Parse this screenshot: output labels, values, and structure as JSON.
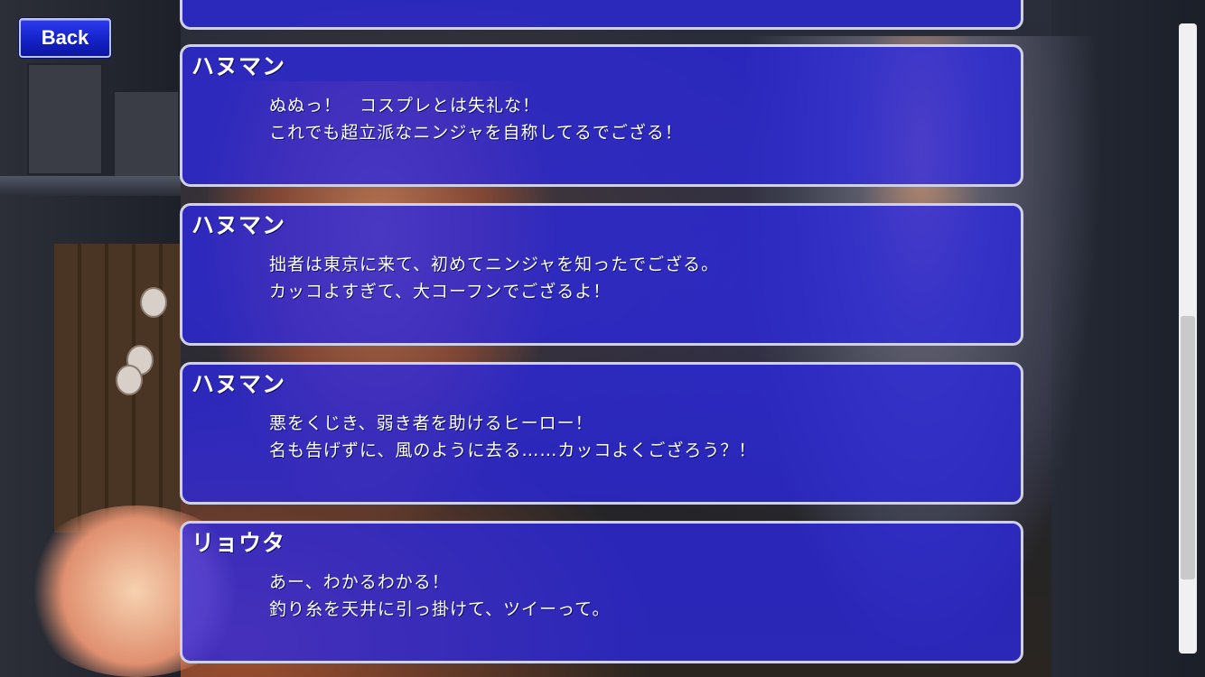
{
  "back_label": "Back",
  "log": [
    {
      "speaker": "",
      "lines": [
        "",
        ""
      ]
    },
    {
      "speaker": "ハヌマン",
      "lines": [
        "ぬぬっ！　コスプレとは失礼な！",
        "これでも超立派なニンジャを自称してるでござる！"
      ]
    },
    {
      "speaker": "ハヌマン",
      "lines": [
        "拙者は東京に来て、初めてニンジャを知ったでござる。",
        "カッコよすぎて、大コーフンでござるよ！"
      ]
    },
    {
      "speaker": "ハヌマン",
      "lines": [
        "悪をくじき、弱き者を助けるヒーロー！",
        "名も告げずに、風のように去る……カッコよくござろう？！"
      ]
    },
    {
      "speaker": "リョウタ",
      "lines": [
        "あー、わかるわかる！",
        "釣り糸を天井に引っ掛けて、ツイーって。"
      ]
    }
  ],
  "colors": {
    "card_fill": "#2c28e2",
    "card_border": "#cfd0e6",
    "button_fill": "#1422c8"
  }
}
